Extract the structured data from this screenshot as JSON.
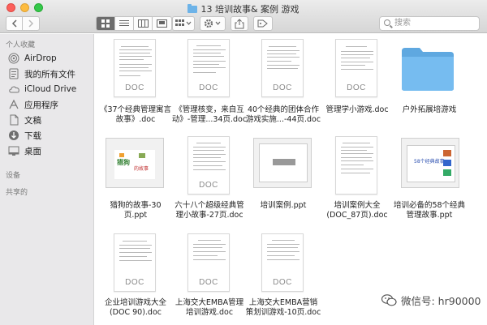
{
  "window": {
    "title": "13 培训故事& 案例 游戏"
  },
  "search": {
    "placeholder": "搜索"
  },
  "sidebar": {
    "favorites_header": "个人收藏",
    "devices_header": "设备",
    "shared_header": "共享的",
    "items": [
      {
        "label": "AirDrop",
        "icon": "airdrop-icon"
      },
      {
        "label": "我的所有文件",
        "icon": "all-files-icon"
      },
      {
        "label": "iCloud Drive",
        "icon": "cloud-icon"
      },
      {
        "label": "应用程序",
        "icon": "applications-icon"
      },
      {
        "label": "文稿",
        "icon": "documents-icon"
      },
      {
        "label": "下载",
        "icon": "downloads-icon"
      },
      {
        "label": "桌面",
        "icon": "desktop-icon"
      }
    ]
  },
  "files": [
    {
      "line1": "《37个经典管理寓言",
      "line2": "故事》.doc",
      "kind": "doc"
    },
    {
      "line1": "《管理核变，来自互",
      "line2": "动》-管理...34页.doc",
      "kind": "doc"
    },
    {
      "line1": "40个经典的团体合作",
      "line2": "游戏实施...-44页.doc",
      "kind": "doc"
    },
    {
      "line1": "管理学小游戏.doc",
      "line2": "",
      "kind": "doc"
    },
    {
      "line1": "户外拓展培游戏",
      "line2": "",
      "kind": "folder"
    },
    {
      "line1": "猎狗的故事-30",
      "line2": "页.ppt",
      "kind": "ppt"
    },
    {
      "line1": "六十八个超级经典管",
      "line2": "理小故事-27页.doc",
      "kind": "doc"
    },
    {
      "line1": "培训案例.ppt",
      "line2": "",
      "kind": "ppt"
    },
    {
      "line1": "培训案例大全",
      "line2": "(DOC_87页).doc",
      "kind": "doc"
    },
    {
      "line1": "培训必备的58个经典",
      "line2": "管理故事.ppt",
      "kind": "ppt"
    },
    {
      "line1": "企业培训游戏大全",
      "line2": "(DOC 90).doc",
      "kind": "doc"
    },
    {
      "line1": "上海交大EMBA管理",
      "line2": "培训游戏.doc",
      "kind": "doc"
    },
    {
      "line1": "上海交大EMBA营销",
      "line2": "策划训游戏-10页.doc",
      "kind": "doc"
    }
  ],
  "thumbs": {
    "doc_label": "DOC",
    "ppt1_title": "猎狗",
    "ppt1_sub": "的故事",
    "ppt3_title": "58个经典故事"
  },
  "watermark": {
    "text": "微信号: hr90000"
  },
  "colors": {
    "accent": "#3d8be6",
    "folder": "#6db3e8",
    "sidebar": "#e9e8ea"
  }
}
